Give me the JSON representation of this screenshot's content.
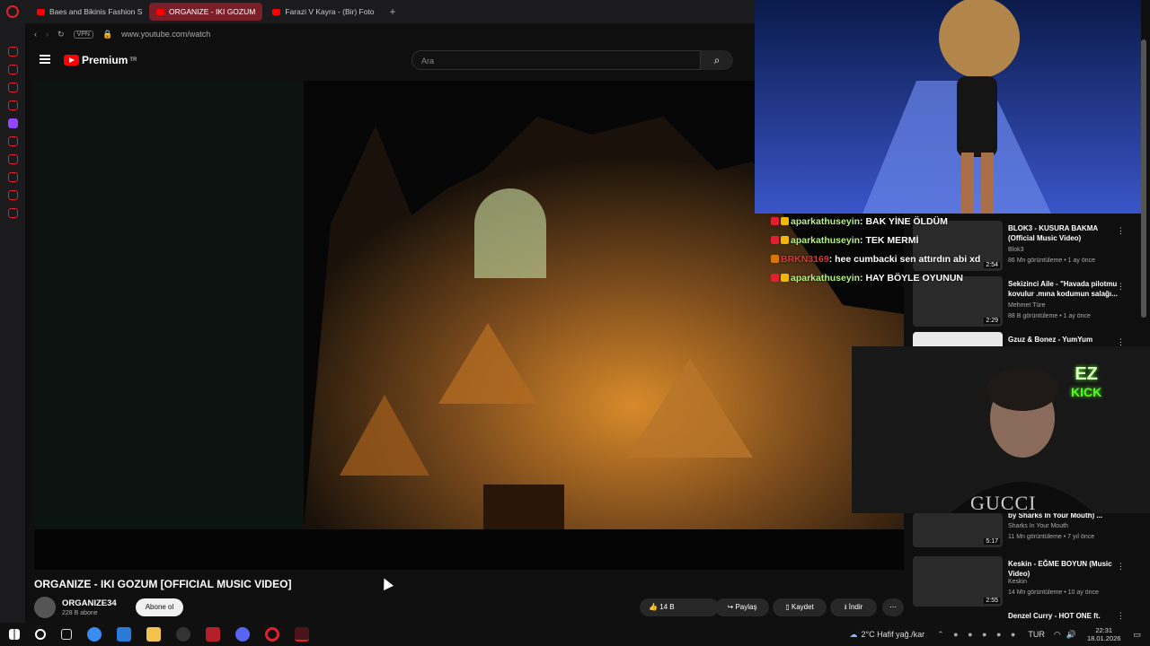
{
  "tabs": [
    {
      "label": "Baes and Bikinis Fashion S"
    },
    {
      "label": "ORGANIZE - IKI GOZUM"
    },
    {
      "label": "Farazi V Kayra - (Bir) Foto"
    }
  ],
  "address": {
    "vpn": "VPN",
    "url": "www.youtube.com/watch"
  },
  "header": {
    "logo": "Premium",
    "logo_sup": "TR",
    "search_placeholder": "Ara"
  },
  "video": {
    "title": "ORGANIZE - IKI GOZUM [OFFICIAL MUSIC VIDEO]",
    "channel": "ORGANIZE34",
    "subscribers": "228 B abone",
    "subscribe_label": "Abone ol",
    "likes": "14 B",
    "share_label": "Paylaş",
    "save_label": "Kaydet",
    "download_label": "İndir"
  },
  "chat": [
    {
      "user": "aparkathuseyin",
      "message": " : BAK YİNE ÖLDÜM"
    },
    {
      "user": "aparkathuseyin",
      "message": " : TEK MERMİ"
    },
    {
      "user": "BRKN3169",
      "message": " : hee cumbacki sen attırdın abi xd"
    },
    {
      "user": "aparkathuseyin",
      "message": " : HAY BÖYLE OYUNUN"
    }
  ],
  "recommendations": [
    {
      "title": "BLOK3 - KUSURA BAKMA (Official Music Video)",
      "channel": "Blok3",
      "meta": "86 Mn görüntüleme • 1 ay önce",
      "duration": "2:54"
    },
    {
      "title": "Sekizinci Aile - \"Havada pilotmu kovulur .mına kodumun salağı...",
      "channel": "Mehmet Türe",
      "meta": "88 B görüntüleme • 1 ay önce",
      "duration": "2:29"
    },
    {
      "title": "Gzuz & Bonez - YumYum",
      "channel": "",
      "meta": "",
      "duration": ""
    },
    {
      "title": "by Sharks In Your Mouth) ...",
      "channel": "Sharks In Your Mouth",
      "meta": "11 Mn görüntüleme • 7 yıl önce",
      "duration": "5:17"
    },
    {
      "title": "Keskin - EĞME BOYUN (Music Video)",
      "channel": "Keskin",
      "meta": "14 Mn görüntüleme • 10 ay önce",
      "duration": "2:55"
    },
    {
      "title": "Denzel Curry - HOT ONE ft.",
      "channel": "",
      "meta": "",
      "duration": ""
    }
  ],
  "webcam": {
    "logo_top": "EZ",
    "logo_bottom": "KICK",
    "shirt": "GUCCI"
  },
  "taskbar": {
    "weather": "2°C  Hafif yağ./kar",
    "lang": "TUR",
    "time": "22:31",
    "date": "18.01.2026"
  },
  "colors": {
    "accent": "#e0202f",
    "chat_user": "#b5f080",
    "chat_user_alt": "#d13a3a",
    "kick_green": "#53fc18"
  }
}
